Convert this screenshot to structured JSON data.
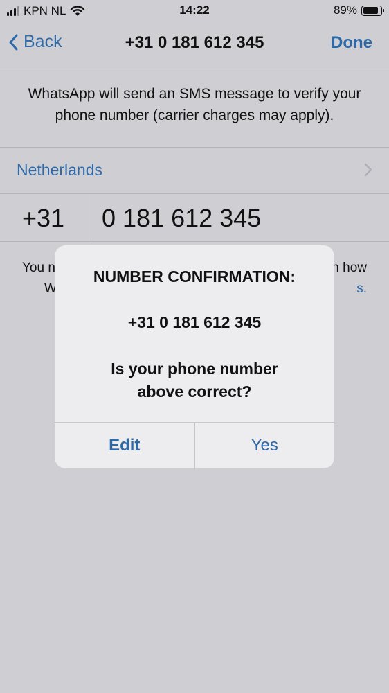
{
  "status": {
    "carrier": "KPN NL",
    "time": "14:22",
    "battery": "89%",
    "battery_level": 0.89
  },
  "nav": {
    "back_label": "Back",
    "title": "+31 0 181 612 345",
    "done_label": "Done"
  },
  "info_text": "WhatsApp will send an SMS message to verify your phone number (carrier charges may apply).",
  "country": {
    "name": "Netherlands"
  },
  "phone": {
    "country_code": "+31",
    "number": "0 181 612 345"
  },
  "fine_print": {
    "left_1": "You n",
    "right_1": "n how",
    "left_2": "W",
    "right_2": "s."
  },
  "alert": {
    "title": "NUMBER CONFIRMATION:",
    "number": "+31 0 181 612 345",
    "question_line1": "Is your phone number",
    "question_line2": "above correct?",
    "edit_label": "Edit",
    "yes_label": "Yes"
  },
  "colors": {
    "accent": "#2e6aa8",
    "background": "#cfced3",
    "alert_bg": "#ededef"
  }
}
